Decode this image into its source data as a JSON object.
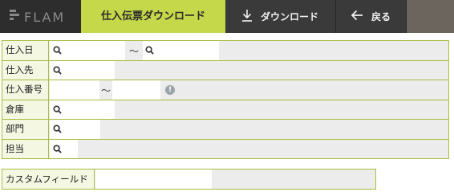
{
  "header": {
    "logo_text": "FLAM",
    "title": "仕入伝票ダウンロード",
    "download_label": "ダウンロード",
    "back_label": "戻る",
    "accent_color": "#c5d84a"
  },
  "form": {
    "rows": [
      {
        "label": "仕入日",
        "range_separator": "〜"
      },
      {
        "label": "仕入先"
      },
      {
        "label": "仕入番号",
        "range_separator": "〜",
        "info_icon": "!"
      },
      {
        "label": "倉庫"
      },
      {
        "label": "部門"
      },
      {
        "label": "担当"
      }
    ],
    "custom_field_label": "カスタムフィールド"
  },
  "icons": {
    "search": "search-icon",
    "download": "download-icon",
    "back": "arrow-left-icon",
    "info": "info-icon"
  }
}
